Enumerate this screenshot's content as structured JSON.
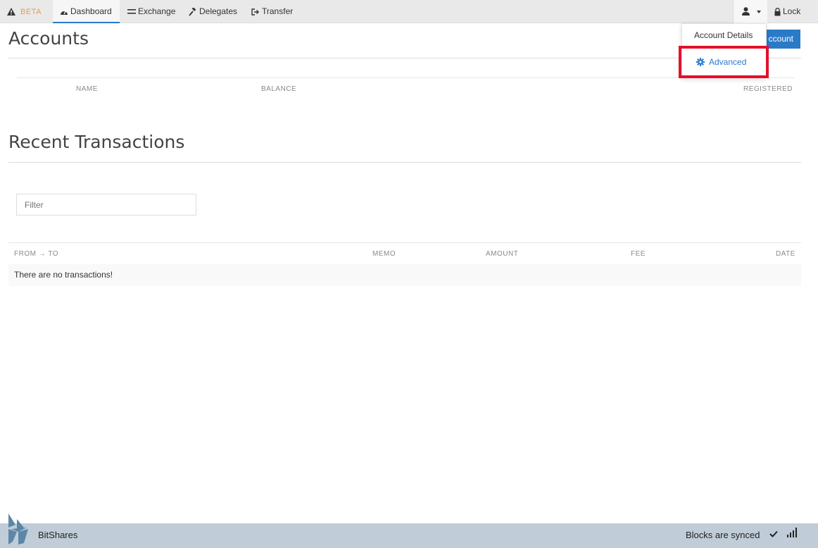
{
  "nav": {
    "beta_label": "BETA",
    "dashboard": "Dashboard",
    "exchange": "Exchange",
    "delegates": "Delegates",
    "transfer": "Transfer",
    "lock": "Lock"
  },
  "accounts": {
    "title": "Accounts",
    "button_label": "ccount",
    "columns": [
      "NAME",
      "BALANCE",
      "REGISTERED"
    ]
  },
  "dropdown": {
    "account_details": "Account Details",
    "advanced": "Advanced"
  },
  "transactions": {
    "title": "Recent Transactions",
    "filter_placeholder": "Filter",
    "columns": [
      "FROM → TO",
      "MEMO",
      "AMOUNT",
      "FEE",
      "DATE"
    ],
    "empty_message": "There are no transactions!"
  },
  "footer": {
    "brand": "BitShares",
    "status": "Blocks are synced"
  },
  "colors": {
    "accent": "#2a7ac8",
    "highlight": "#e3102a",
    "footer_bg": "#c0cdd8"
  }
}
